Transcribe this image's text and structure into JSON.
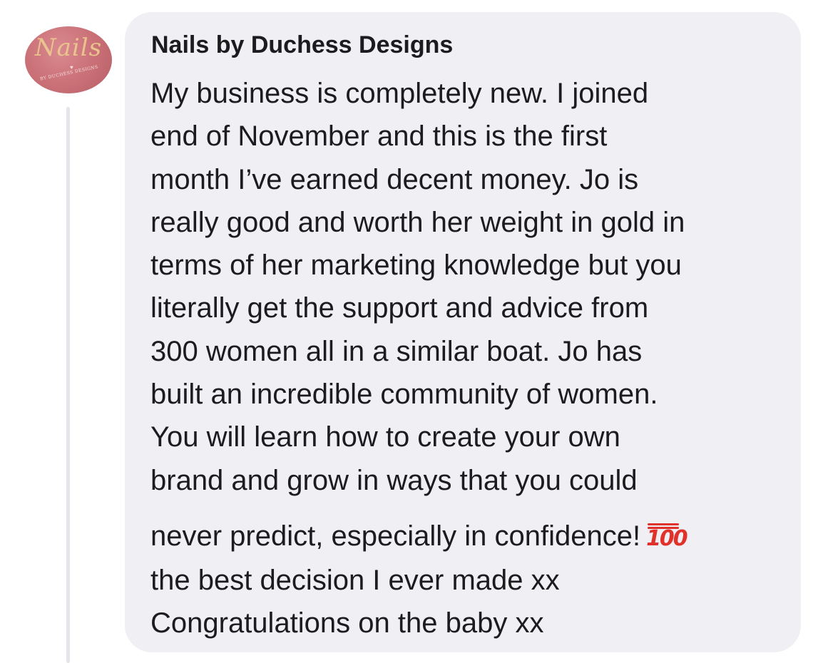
{
  "comment": {
    "author": "Nails by Duchess Designs",
    "avatar": {
      "script_text": "Nails",
      "sub_text": "BY DUCHESS DESIGNS",
      "icon": "heart-icon",
      "color": "#c96f76"
    },
    "lines": [
      "My business is completely new. I joined",
      "end of November and this is the first",
      "month I’ve earned decent money. Jo is",
      "really good and worth her weight in gold in",
      "terms of her marketing knowledge but you",
      "literally get the support and advice from",
      "300 women all in a similar boat. Jo has",
      "built an incredible community of women.",
      "You will learn how to create your own",
      "brand and grow in ways that you could",
      "never predict, especially in confidence!",
      "the best decision I ever made xx",
      "Congratulations on the baby xx"
    ],
    "emoji": {
      "name": "hundred-points-emoji",
      "text": "100",
      "color": "#e0312b"
    }
  },
  "colors": {
    "bubble": "#efeff4",
    "text": "#1c1c1e",
    "thread_line": "#e4e5ea"
  }
}
